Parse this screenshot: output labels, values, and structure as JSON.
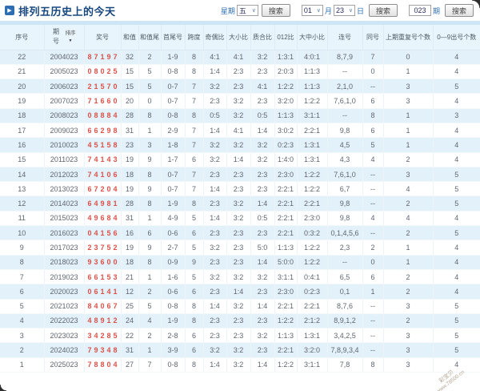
{
  "title": "排列五历史上的今天",
  "toolbar": {
    "week_label": "星期",
    "week_value": "五",
    "month_value": "01",
    "month_label": "月",
    "day_value": "23",
    "day_label": "日",
    "issue_value": "023",
    "issue_label": "期",
    "search_label": "搜索"
  },
  "table": {
    "sort_label": "排序",
    "headers": [
      "序号",
      "期号",
      "奖号",
      "和值",
      "和值尾",
      "首尾号",
      "跨度",
      "奇偶比",
      "大小比",
      "质合比",
      "012比",
      "大中小比",
      "连号",
      "同号",
      "上期重复号个数",
      "0—9出号个数"
    ],
    "rows": [
      [
        "22",
        "2004023",
        "87197",
        "32",
        "2",
        "1-9",
        "8",
        "4:1",
        "4:1",
        "3:2",
        "1:3:1",
        "4:0:1",
        "8,7,9",
        "7",
        "0",
        "4"
      ],
      [
        "21",
        "2005023",
        "08025",
        "15",
        "5",
        "0-8",
        "8",
        "1:4",
        "2:3",
        "2:3",
        "2:0:3",
        "1:1:3",
        "--",
        "0",
        "1",
        "4"
      ],
      [
        "20",
        "2006023",
        "21570",
        "15",
        "5",
        "0-7",
        "7",
        "3:2",
        "2:3",
        "4:1",
        "1:2:2",
        "1:1:3",
        "2,1,0",
        "--",
        "3",
        "5"
      ],
      [
        "19",
        "2007023",
        "71660",
        "20",
        "0",
        "0-7",
        "7",
        "2:3",
        "3:2",
        "2:3",
        "3:2:0",
        "1:2:2",
        "7,6,1,0",
        "6",
        "3",
        "4"
      ],
      [
        "18",
        "2008023",
        "08884",
        "28",
        "8",
        "0-8",
        "8",
        "0:5",
        "3:2",
        "0:5",
        "1:1:3",
        "3:1:1",
        "--",
        "8",
        "1",
        "3"
      ],
      [
        "17",
        "2009023",
        "66298",
        "31",
        "1",
        "2-9",
        "7",
        "1:4",
        "4:1",
        "1:4",
        "3:0:2",
        "2:2:1",
        "9,8",
        "6",
        "1",
        "4"
      ],
      [
        "16",
        "2010023",
        "45158",
        "23",
        "3",
        "1-8",
        "7",
        "3:2",
        "3:2",
        "3:2",
        "0:2:3",
        "1:3:1",
        "4,5",
        "5",
        "1",
        "4"
      ],
      [
        "15",
        "2011023",
        "74143",
        "19",
        "9",
        "1-7",
        "6",
        "3:2",
        "1:4",
        "3:2",
        "1:4:0",
        "1:3:1",
        "4,3",
        "4",
        "2",
        "4"
      ],
      [
        "14",
        "2012023",
        "74106",
        "18",
        "8",
        "0-7",
        "7",
        "2:3",
        "2:3",
        "2:3",
        "2:3:0",
        "1:2:2",
        "7,6,1,0",
        "--",
        "3",
        "5"
      ],
      [
        "13",
        "2013023",
        "67204",
        "19",
        "9",
        "0-7",
        "7",
        "1:4",
        "2:3",
        "2:3",
        "2:2:1",
        "1:2:2",
        "6,7",
        "--",
        "4",
        "5"
      ],
      [
        "12",
        "2014023",
        "64981",
        "28",
        "8",
        "1-9",
        "8",
        "2:3",
        "3:2",
        "1:4",
        "2:2:1",
        "2:2:1",
        "9,8",
        "--",
        "2",
        "5"
      ],
      [
        "11",
        "2015023",
        "49684",
        "31",
        "1",
        "4-9",
        "5",
        "1:4",
        "3:2",
        "0:5",
        "2:2:1",
        "2:3:0",
        "9,8",
        "4",
        "4",
        "4"
      ],
      [
        "10",
        "2016023",
        "04156",
        "16",
        "6",
        "0-6",
        "6",
        "2:3",
        "2:3",
        "2:3",
        "2:2:1",
        "0:3:2",
        "0,1,4,5,6",
        "--",
        "2",
        "5"
      ],
      [
        "9",
        "2017023",
        "23752",
        "19",
        "9",
        "2-7",
        "5",
        "3:2",
        "2:3",
        "5:0",
        "1:1:3",
        "1:2:2",
        "2,3",
        "2",
        "1",
        "4"
      ],
      [
        "8",
        "2018023",
        "93600",
        "18",
        "8",
        "0-9",
        "9",
        "2:3",
        "2:3",
        "1:4",
        "5:0:0",
        "1:2:2",
        "--",
        "0",
        "1",
        "4"
      ],
      [
        "7",
        "2019023",
        "66153",
        "21",
        "1",
        "1-6",
        "5",
        "3:2",
        "3:2",
        "3:2",
        "3:1:1",
        "0:4:1",
        "6,5",
        "6",
        "2",
        "4"
      ],
      [
        "6",
        "2020023",
        "06141",
        "12",
        "2",
        "0-6",
        "6",
        "2:3",
        "1:4",
        "2:3",
        "2:3:0",
        "0:2:3",
        "0,1",
        "1",
        "2",
        "4"
      ],
      [
        "5",
        "2021023",
        "84067",
        "25",
        "5",
        "0-8",
        "8",
        "1:4",
        "3:2",
        "1:4",
        "2:2:1",
        "2:2:1",
        "8,7,6",
        "--",
        "3",
        "5"
      ],
      [
        "4",
        "2022023",
        "48912",
        "24",
        "4",
        "1-9",
        "8",
        "2:3",
        "2:3",
        "2:3",
        "1:2:2",
        "2:1:2",
        "8,9,1,2",
        "--",
        "2",
        "5"
      ],
      [
        "3",
        "2023023",
        "34285",
        "22",
        "2",
        "2-8",
        "6",
        "2:3",
        "2:3",
        "3:2",
        "1:1:3",
        "1:3:1",
        "3,4,2,5",
        "--",
        "3",
        "5"
      ],
      [
        "2",
        "2024023",
        "79348",
        "31",
        "1",
        "3-9",
        "6",
        "3:2",
        "3:2",
        "2:3",
        "2:2:1",
        "3:2:0",
        "7,8,9,3,4",
        "--",
        "3",
        "5"
      ],
      [
        "1",
        "2025023",
        "78804",
        "27",
        "7",
        "0-8",
        "8",
        "1:4",
        "3:2",
        "1:4",
        "1:2:2",
        "3:1:1",
        "7,8",
        "8",
        "3",
        "4"
      ]
    ]
  },
  "watermark": {
    "line1": "彩宝贝",
    "line2": "www.78500.cn"
  },
  "colors": {
    "prize_red": "#d9534a",
    "label_blue": "#2e6eb5",
    "row_alt_blue": "#e3f1fa",
    "title_navy": "#17487e"
  }
}
